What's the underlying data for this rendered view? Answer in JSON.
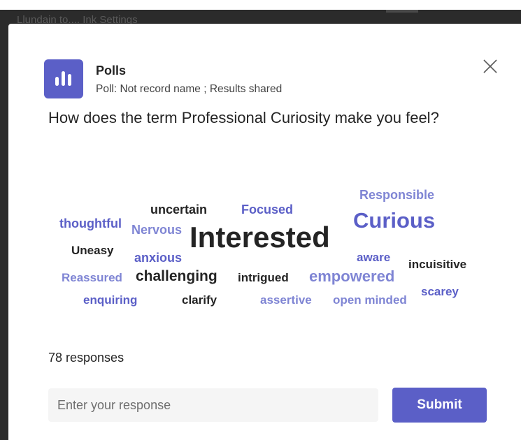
{
  "background": {
    "window_title": "Llundain to.... Ink Settings"
  },
  "dialog": {
    "app_name": "Polls",
    "subtitle": "Poll: Not record name ; Results shared",
    "question": "How does the term Professional Curiosity make you feel?",
    "close_icon": "close-icon",
    "app_icon": "polls-bar-chart-icon"
  },
  "word_cloud": {
    "colors": {
      "dark": "#242424",
      "accent": "#5b5fc7",
      "light": "#7f85d4"
    },
    "words": [
      {
        "text": "Responsible",
        "color": "light"
      },
      {
        "text": "uncertain",
        "color": "dark"
      },
      {
        "text": "Focused",
        "color": "accent"
      },
      {
        "text": "Curious",
        "color": "accent"
      },
      {
        "text": "thoughtful",
        "color": "accent"
      },
      {
        "text": "Nervous",
        "color": "light"
      },
      {
        "text": "Interested",
        "color": "dark"
      },
      {
        "text": "Uneasy",
        "color": "dark"
      },
      {
        "text": "anxious",
        "color": "accent"
      },
      {
        "text": "aware",
        "color": "accent"
      },
      {
        "text": "incuisitive",
        "color": "dark"
      },
      {
        "text": "Reassured",
        "color": "light"
      },
      {
        "text": "challenging",
        "color": "dark"
      },
      {
        "text": "intrigued",
        "color": "dark"
      },
      {
        "text": "empowered",
        "color": "light"
      },
      {
        "text": "scarey",
        "color": "accent"
      },
      {
        "text": "enquiring",
        "color": "accent"
      },
      {
        "text": "clarify",
        "color": "dark"
      },
      {
        "text": "assertive",
        "color": "light"
      },
      {
        "text": "open minded",
        "color": "light"
      }
    ]
  },
  "responses_text": "78 responses",
  "input": {
    "placeholder": "Enter your response"
  },
  "submit_label": "Submit"
}
